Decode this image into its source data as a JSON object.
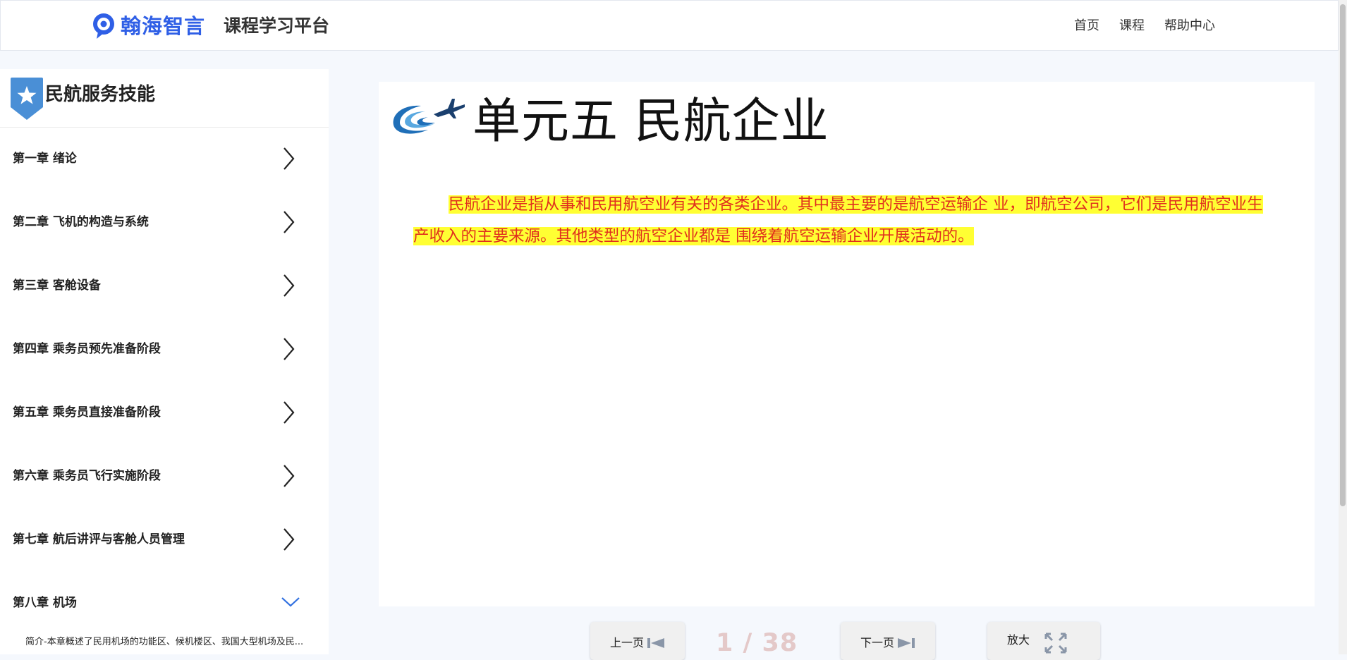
{
  "header": {
    "brand_name": "翰海智言",
    "platform_name": "课程学习平台",
    "nav": [
      "首页",
      "课程",
      "帮助中心"
    ]
  },
  "sidebar": {
    "course_title": "民航服务技能",
    "chapters": [
      "第一章 绪论",
      "第二章 飞机的构造与系统",
      "第三章 客舱设备",
      "第四章 乘务员预先准备阶段",
      "第五章 乘务员直接准备阶段",
      "第六章 乘务员飞行实施阶段",
      "第七章 航后讲评与客舱人员管理",
      "第八章 机场"
    ],
    "expanded_intro": "简介-本章概述了民用机场的功能区、候机楼区、我国大型机场及民..."
  },
  "document": {
    "title": "单元五 民航企业",
    "paragraph": "民航企业是指从事和民用航空业有关的各类企业。其中最主要的是航空运输企 业，即航空公司，它们是民用航空业生产收入的主要来源。其他类型的航空企业都是 围绕着航空运输企业开展活动的。"
  },
  "controls": {
    "prev_label": "上一页",
    "next_label": "下一页",
    "zoom_label": "放大",
    "page_indicator": "1 / 38"
  },
  "colors": {
    "brand_blue": "#2f5fe6",
    "badge_blue": "#4a8fd6",
    "highlight_yellow": "#ffff33",
    "text_red": "#e0301e",
    "page_indicator": "#e4c9c9"
  },
  "icons": {
    "brand": "chat-bubble-logo-icon",
    "course_badge": "star-badge-icon",
    "chapter_toggle": "chevron-right-icon",
    "expanded_toggle": "chevron-down-icon",
    "doc_logo": "airplane-swoosh-icon",
    "prev": "skip-back-icon",
    "next": "skip-forward-icon",
    "zoom": "expand-icon"
  }
}
